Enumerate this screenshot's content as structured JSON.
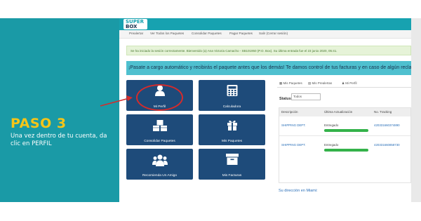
{
  "instruction": {
    "step": "PASO 3",
    "text": "Una vez dentro de tu cuenta, da clic en PERFIL"
  },
  "brand": {
    "line1": "SUPER",
    "line2": "BOX"
  },
  "nav": [
    "Prealertar",
    "Ver Todos los Paquetes",
    "Consolidar Paquetes",
    "Pagar Paquetes",
    "Salir (Cerrar sesión)"
  ],
  "alerts": {
    "success": "Se ha iniciado la sesión correctamente. Bienvenido (a) Ana Victoria Camacho - SB101950 (P.O. Box). Su última entrada fue el 23 junio 2020, 05:41.",
    "info": "¡Pasate a cargo automático y recibirás el paquete antes que los demás! Te damos control de tus facturas y en caso de algún reclamo"
  },
  "tiles": [
    "Mi Perfil",
    "Calculadora",
    "Consolidar Paquetes",
    "Mis Paquetes",
    "Recomienda Un Amigo",
    "Mis Facturas"
  ],
  "panel": {
    "tabs": [
      "Mis Paquetes",
      "Mis Prealertas",
      "Mi Perfil"
    ],
    "status_label": "Status",
    "status_value": "Todos",
    "table": {
      "headers": [
        "Descripción",
        "Última Actualización",
        "No. Tracking"
      ],
      "rows": [
        {
          "description": "SHIPPING DEPT.",
          "update": "Entregado",
          "tracking": "420331660374890"
        },
        {
          "description": "SHIPPING DEPT.",
          "update": "Entregado",
          "tracking": "420331660858730"
        }
      ]
    },
    "address_heading": "Su dirección en Miami:"
  },
  "colors": {
    "teal_panel": "#1a9aa6",
    "accent_yellow": "#f5c518",
    "tile_blue": "#1e4b7a",
    "highlight_red": "#d62b2b",
    "progress_green": "#34b24a"
  }
}
